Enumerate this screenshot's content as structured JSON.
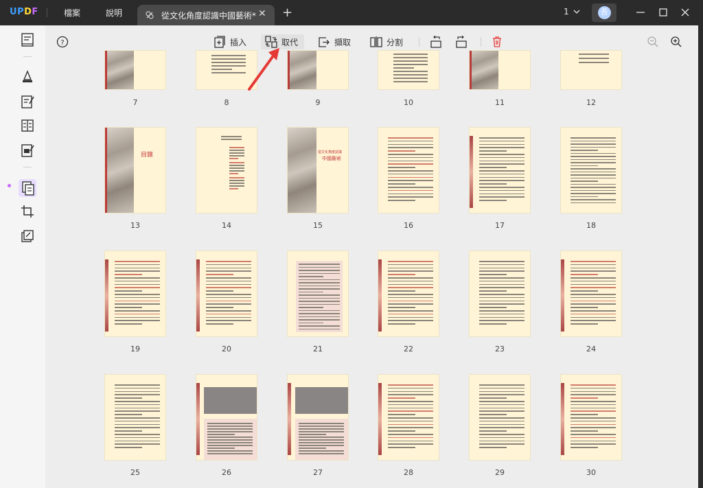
{
  "app": {
    "logo": "UPDF",
    "menu": [
      "檔案",
      "說明"
    ],
    "tab_title": "從文化角度認識中國藝術*",
    "tab_close": "✕",
    "tab_add": "+",
    "page_indicator": "1",
    "avatar_initial": "吾"
  },
  "toolbar": {
    "help_icon": "?",
    "insert_label": "插入",
    "replace_label": "取代",
    "extract_label": "擷取",
    "split_label": "分割"
  },
  "pages": [
    "7",
    "8",
    "9",
    "10",
    "11",
    "12",
    "13",
    "14",
    "15",
    "16",
    "17",
    "18",
    "19",
    "20",
    "21",
    "22",
    "23",
    "24",
    "25",
    "26",
    "27",
    "28",
    "29",
    "30"
  ],
  "thumb_texts": {
    "contents_title": "目錄",
    "cover_title_line1": "從文化角度認識",
    "cover_title_line2": "中國藝術"
  },
  "colors": {
    "titlebar": "#2b2b2b",
    "page_bg": "#fff5d6",
    "accent_red": "#e53935",
    "accent_purple": "#c86bff"
  },
  "icons": [
    "help-icon",
    "insert-icon",
    "replace-icon",
    "extract-icon",
    "split-icon",
    "rotate-left-icon",
    "rotate-right-icon",
    "trash-icon",
    "zoom-out-icon",
    "zoom-in-icon"
  ]
}
